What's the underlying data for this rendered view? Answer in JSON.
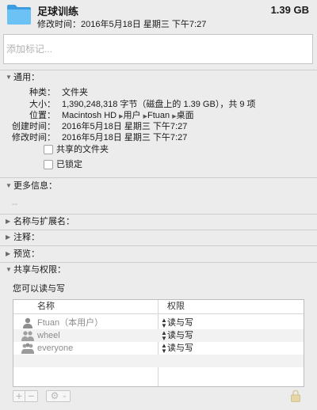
{
  "header": {
    "name": "足球训练",
    "size": "1.39 GB",
    "modified": "修改时间：2016年5月18日 星期三 下午7:27"
  },
  "tags": {
    "placeholder": "添加标记..."
  },
  "sections": {
    "general": "通用：",
    "more_info": "更多信息：",
    "name_ext": "名称与扩展名：",
    "comments": "注释：",
    "preview": "预览：",
    "sharing": "共享与权限："
  },
  "general": {
    "rows": [
      {
        "label": "种类：",
        "value": "文件夹"
      },
      {
        "label": "大小：",
        "value": "1,390,248,318 字节（磁盘上的 1.39 GB），共 9 项"
      },
      {
        "label": "位置：",
        "value": ""
      },
      {
        "label": "创建时间：",
        "value": "2016年5月18日 星期三 下午7:27"
      },
      {
        "label": "修改时间：",
        "value": "2016年5月18日 星期三 下午7:27"
      }
    ],
    "path": [
      "Macintosh HD",
      "用户",
      "Ftuan",
      "桌面"
    ],
    "shared_folder": "共享的文件夹",
    "locked": "已锁定"
  },
  "more_info": {
    "value": "--"
  },
  "permissions": {
    "summary": "您可以读与写",
    "headers": {
      "name": "名称",
      "privilege": "权限"
    },
    "rows": [
      {
        "name": "Ftuan（本用户）",
        "privilege": "读与写",
        "icon": "user-icon"
      },
      {
        "name": "wheel",
        "privilege": "读与写",
        "icon": "group-icon"
      },
      {
        "name": "everyone",
        "privilege": "读与写",
        "icon": "everyone-icon"
      }
    ]
  },
  "toolbar": {
    "add": "+",
    "remove": "−",
    "action": "⚙",
    "action_caret": "⌄"
  },
  "colors": {
    "folder": "#5fb8f0",
    "folder_dark": "#3c9ee0",
    "text": "#1a1a1a",
    "disabled": "#8c8c8c"
  }
}
